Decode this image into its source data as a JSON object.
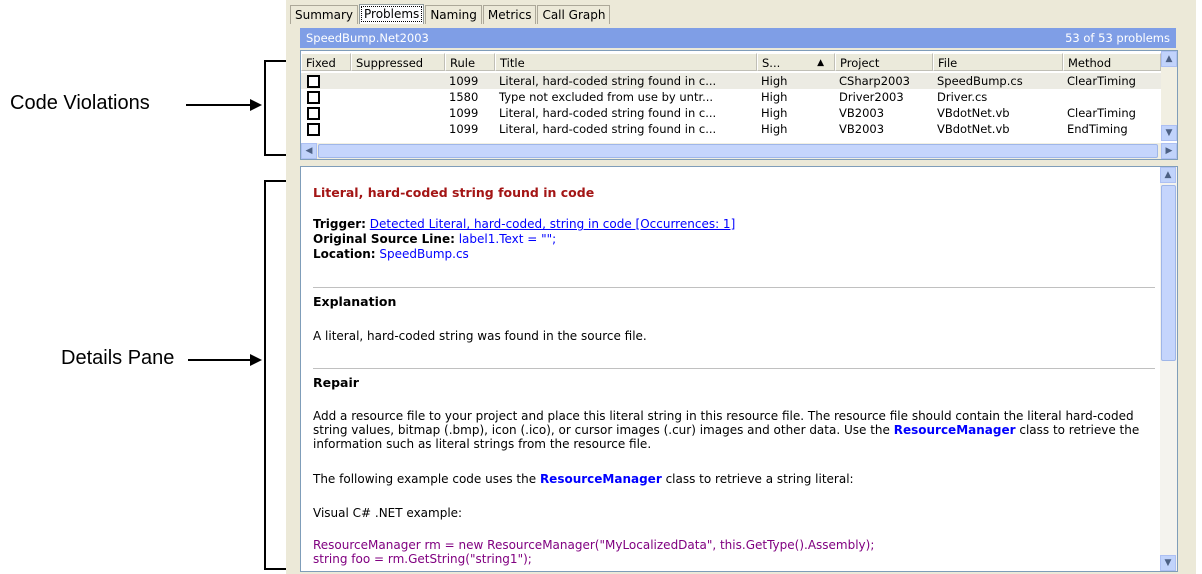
{
  "annotations": {
    "code_violations": "Code Violations",
    "details_pane": "Details Pane"
  },
  "tabs": [
    {
      "label": "Summary"
    },
    {
      "label": "Problems"
    },
    {
      "label": "Naming"
    },
    {
      "label": "Metrics"
    },
    {
      "label": "Call Graph"
    }
  ],
  "problems_bar": {
    "project": "SpeedBump.Net2003",
    "count_text": "53 of 53 problems"
  },
  "grid": {
    "columns": [
      "Fixed",
      "Suppressed",
      "Rule",
      "Title",
      "S...",
      "Project",
      "File",
      "Method"
    ],
    "rows": [
      {
        "rule": "1099",
        "title": "Literal, hard-coded string found in c...",
        "severity": "High",
        "project": "CSharp2003",
        "file": "SpeedBump.cs",
        "method": "ClearTiming"
      },
      {
        "rule": "1580",
        "title": "Type not excluded from use by untr...",
        "severity": "High",
        "project": "Driver2003",
        "file": "Driver.cs",
        "method": ""
      },
      {
        "rule": "1099",
        "title": "Literal, hard-coded string found in c...",
        "severity": "High",
        "project": "VB2003",
        "file": "VBdotNet.vb",
        "method": "ClearTiming"
      },
      {
        "rule": "1099",
        "title": "Literal, hard-coded string found in c...",
        "severity": "High",
        "project": "VB2003",
        "file": "VBdotNet.vb",
        "method": "EndTiming"
      }
    ]
  },
  "details": {
    "title": "Literal, hard-coded string found in code",
    "trigger_label": "Trigger:",
    "trigger_link": "Detected Literal, hard-coded, string in code [Occurrences: 1]",
    "source_label": "Original Source Line:",
    "source_value": "label1.Text = \"\";",
    "location_label": "Location:",
    "location_value": "SpeedBump.cs",
    "explanation_heading": "Explanation",
    "explanation_text": "A literal, hard-coded string was found in the source file.",
    "repair_heading": "Repair",
    "repair_p1_a": "Add a resource file to your project and place this literal string in this resource file. The resource file should contain the literal hard-coded string values, bitmap (.bmp), icon (.ico), or cursor images (.cur) images and other data. Use the ",
    "repair_p1_kw": "ResourceManager",
    "repair_p1_b": " class to retrieve the information such as literal strings from the resource file.",
    "repair_p2_a": "The following example code uses the ",
    "repair_p2_kw": "ResourceManager",
    "repair_p2_b": " class to retrieve a string literal:",
    "example_label": "Visual C# .NET example:",
    "code_line1": "ResourceManager rm = new ResourceManager(\"MyLocalizedData\", this.GetType().Assembly);",
    "code_line2": "string foo = rm.GetString(\"string1\");"
  }
}
